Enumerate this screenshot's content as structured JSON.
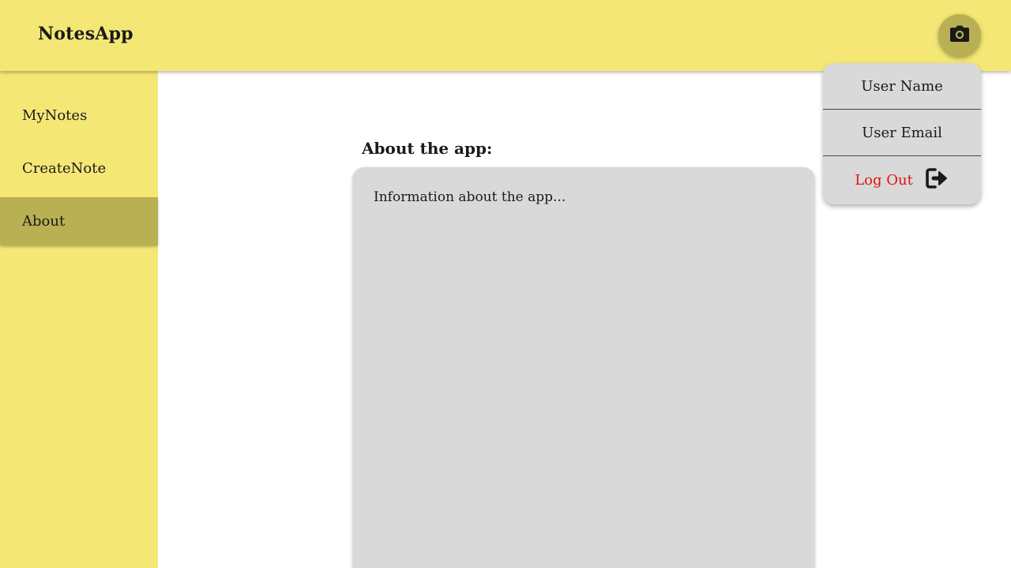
{
  "header": {
    "title": "NotesApp",
    "avatar_icon": "camera-icon"
  },
  "sidebar": {
    "items": [
      {
        "label": "MyNotes",
        "active": false
      },
      {
        "label": "CreateNote",
        "active": false
      },
      {
        "label": "About",
        "active": true
      }
    ]
  },
  "main": {
    "heading": "About the app:",
    "content": "Information about the app..."
  },
  "user_menu": {
    "user_name": "User Name",
    "user_email": "User Email",
    "logout_label": "Log Out",
    "logout_icon": "logout-icon"
  },
  "colors": {
    "brand_yellow": "#f5e775",
    "active_olive": "#b8b052",
    "card_gray": "#d9d9d9",
    "logout_red": "#e11111"
  }
}
